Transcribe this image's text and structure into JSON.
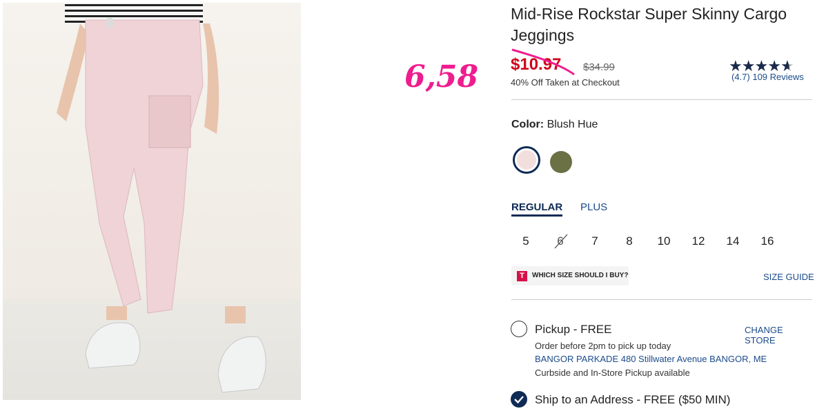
{
  "annotation": "6,58",
  "product": {
    "title": "Mid-Rise Rockstar Super Skinny Cargo Jeggings",
    "sale_price": "$10.97",
    "original_price": "$34.99",
    "promo": "40% Off Taken at Checkout",
    "rating_text": "(4.7) 109 Reviews",
    "rating_value": 4.7,
    "rating_max": 5
  },
  "color": {
    "label": "Color:",
    "selected": "Blush Hue",
    "swatches": [
      {
        "name": "Blush Hue",
        "hex": "#f3dede",
        "selected": true
      },
      {
        "name": "Olive",
        "hex": "#6b7045",
        "selected": false
      }
    ]
  },
  "fit": {
    "tabs": [
      {
        "label": "REGULAR",
        "active": true
      },
      {
        "label": "PLUS",
        "active": false
      }
    ]
  },
  "sizes": [
    {
      "label": "5",
      "available": true
    },
    {
      "label": "6",
      "available": false
    },
    {
      "label": "7",
      "available": true
    },
    {
      "label": "8",
      "available": true
    },
    {
      "label": "10",
      "available": true
    },
    {
      "label": "12",
      "available": true
    },
    {
      "label": "14",
      "available": true
    },
    {
      "label": "16",
      "available": true
    }
  ],
  "fit_finder": {
    "icon_letter": "T",
    "label": "WHICH SIZE SHOULD I BUY?"
  },
  "size_guide": "SIZE GUIDE",
  "pickup": {
    "label": "Pickup - FREE",
    "change_store": "CHANGE STORE",
    "order_before": "Order before 2pm to pick up today",
    "store": "BANGOR PARKADE 480 Stillwater Avenue  BANGOR, ME",
    "availability": "Curbside and In-Store Pickup available"
  },
  "ship": {
    "label": "Ship to an Address - FREE ($50 MIN)"
  },
  "colors": {
    "accent": "#0e2a55",
    "sale": "#d0021b",
    "link": "#1b4b8a",
    "annotation": "#ee1d8e"
  }
}
